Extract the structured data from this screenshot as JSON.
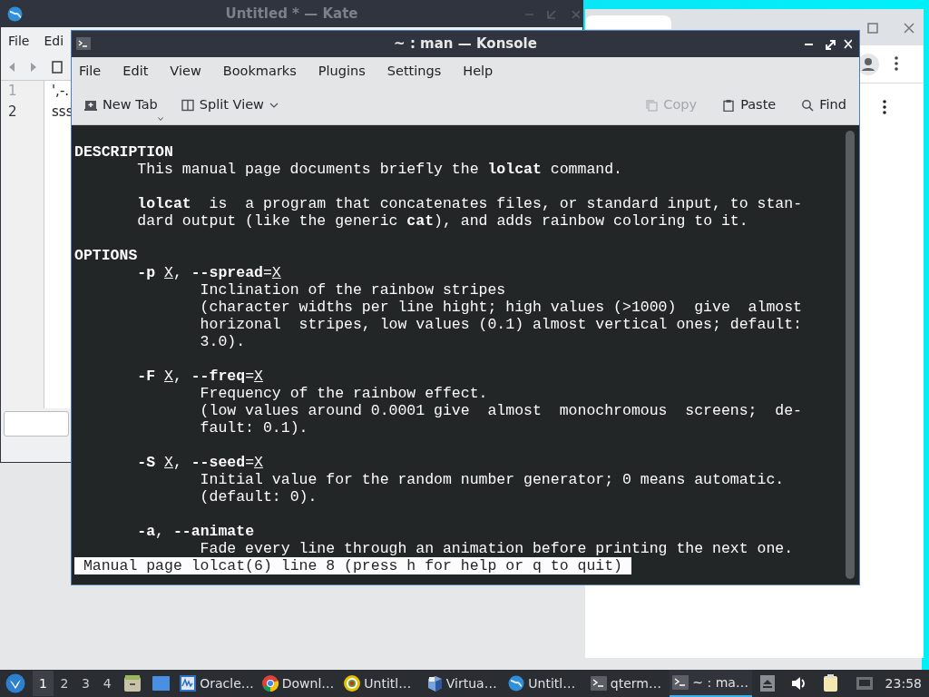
{
  "kate_window": {
    "title": "Untitled * — Kate",
    "menu": [
      "File",
      "Edi"
    ],
    "lines": [
      {
        "number": "1",
        "text": "',-.",
        "current": false
      },
      {
        "number": "2",
        "text": "sss",
        "current": true
      }
    ]
  },
  "konsole": {
    "title": "~ : man — Konsole",
    "menu": [
      "File",
      "Edit",
      "View",
      "Bookmarks",
      "Plugins",
      "Settings",
      "Help"
    ],
    "toolbar": [
      {
        "label": "New Tab",
        "kind": "new_tab",
        "disabled": false
      },
      {
        "label": "Split View",
        "kind": "split_view",
        "disabled": false
      },
      {
        "label": "Copy",
        "kind": "copy",
        "disabled": true
      },
      {
        "label": "Paste",
        "kind": "paste",
        "disabled": false
      },
      {
        "label": "Find",
        "kind": "find",
        "disabled": false
      }
    ],
    "terminal": {
      "blocks": [
        {
          "lines": [
            {
              "kind": "heading",
              "parts": [
                {
                  "text": "DESCRIPTION",
                  "kind": "bold"
                }
              ]
            },
            {
              "kind": "body",
              "parts": [
                "This manual page documents briefly the ",
                {
                  "text": "lolcat",
                  "kind": "bold"
                },
                " command."
              ]
            }
          ]
        },
        {
          "lines": [
            {
              "kind": "body",
              "parts": [
                {
                  "text": "lolcat",
                  "kind": "bold"
                },
                "  is  a program that concatenates files, or standard input, to stan-"
              ]
            },
            {
              "kind": "body",
              "parts": [
                "dard output (like the generic ",
                {
                  "text": "cat",
                  "kind": "bold"
                },
                "), and adds rainbow coloring to it."
              ]
            }
          ]
        },
        {
          "lines": [
            {
              "kind": "heading",
              "parts": [
                {
                  "text": "OPTIONS",
                  "kind": "bold"
                }
              ]
            },
            {
              "kind": "body",
              "parts": [
                {
                  "text": "-p",
                  "kind": "bold"
                },
                {
                  "text": "X",
                  "kind": "underline"
                },
                ", ",
                {
                  "text": "--spread",
                  "kind": "bold"
                },
                "=",
                {
                  "text": "X",
                  "kind": "underline"
                }
              ]
            },
            {
              "kind": "detail",
              "parts": [
                "Inclination of the rainbow stripes"
              ]
            },
            {
              "kind": "detail",
              "parts": [
                "(character widths per line hight; high values (>1000)  give  almost"
              ]
            },
            {
              "kind": "detail",
              "parts": [
                "horizonal  stripes, low values (0.1) almost vertical ones; default:"
              ]
            },
            {
              "kind": "detail",
              "parts": [
                "3.0)."
              ]
            }
          ]
        },
        {
          "lines": [
            {
              "kind": "body",
              "parts": [
                {
                  "text": "-F",
                  "kind": "bold"
                },
                {
                  "text": "X",
                  "kind": "underline"
                },
                ", ",
                {
                  "text": "--freq",
                  "kind": "bold"
                },
                "=",
                {
                  "text": "X",
                  "kind": "underline"
                }
              ]
            },
            {
              "kind": "detail",
              "parts": [
                "Frequency of the rainbow effect."
              ]
            },
            {
              "kind": "detail",
              "parts": [
                "(low values around 0.0001 give  almost  monochromous  screens;  de-"
              ]
            },
            {
              "kind": "detail",
              "parts": [
                "fault: 0.1)."
              ]
            }
          ]
        },
        {
          "lines": [
            {
              "kind": "body",
              "parts": [
                {
                  "text": "-S",
                  "kind": "bold"
                },
                {
                  "text": "X",
                  "kind": "underline"
                },
                ", ",
                {
                  "text": "--seed",
                  "kind": "bold"
                },
                "=",
                {
                  "text": "X",
                  "kind": "underline"
                }
              ]
            },
            {
              "kind": "detail",
              "parts": [
                "Initial value for the random number generator; 0 means automatic."
              ]
            },
            {
              "kind": "detail",
              "parts": [
                "(default: 0)."
              ]
            }
          ]
        },
        {
          "lines": [
            {
              "kind": "body",
              "parts": [
                {
                  "text": "-a",
                  "kind": "bold"
                },
                ", ",
                {
                  "text": "--animate",
                  "kind": "bold"
                }
              ]
            },
            {
              "kind": "detail",
              "parts": [
                "Fade every line through an animation before printing the next one."
              ]
            }
          ]
        }
      ],
      "status": "Manual page lolcat(6) line 8 (press h for help or q to quit)"
    }
  },
  "taskbar": {
    "workspaces": [
      {
        "label": "1",
        "selected": true
      },
      {
        "label": "2",
        "selected": false
      },
      {
        "label": "3",
        "selected": false
      },
      {
        "label": "4",
        "selected": false
      }
    ],
    "tasks": [
      {
        "label": "Oracle…",
        "kind": "monitor",
        "selected": false
      },
      {
        "label": "Downl…",
        "kind": "chrome",
        "selected": false
      },
      {
        "label": "Untitl…",
        "kind": "target",
        "selected": false
      },
      {
        "label": "Virtua…",
        "kind": "virtualbox",
        "selected": false
      },
      {
        "label": "Untitl…",
        "kind": "globe",
        "selected": false
      },
      {
        "label": "qterm…",
        "kind": "terminal",
        "selected": false
      },
      {
        "label": "~ : ma…",
        "kind": "terminal",
        "selected": true
      }
    ],
    "clock": "23:58"
  }
}
